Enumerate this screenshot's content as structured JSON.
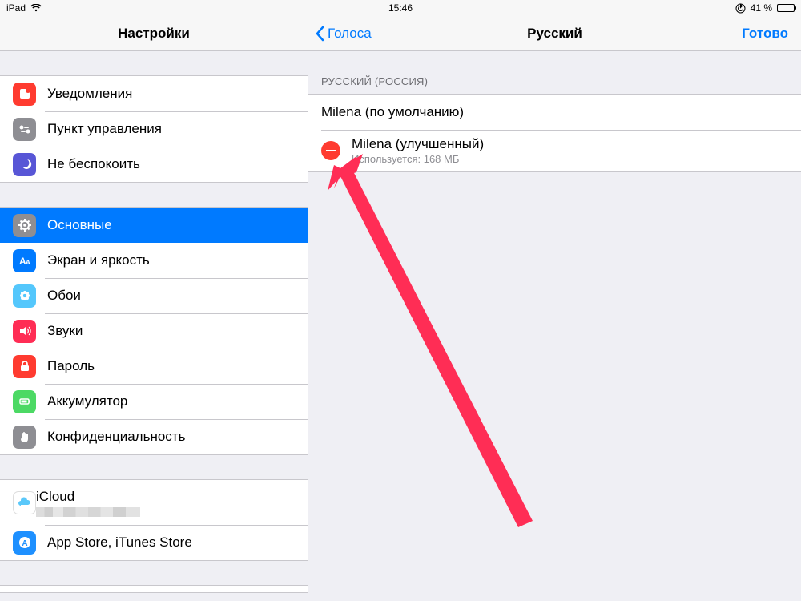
{
  "status": {
    "device": "iPad",
    "time": "15:46",
    "battery_pct": "41 %"
  },
  "sidebar": {
    "title": "Настройки",
    "groups": [
      {
        "items": [
          {
            "id": "notifications",
            "label": "Уведомления",
            "bg": "#ff3b30"
          },
          {
            "id": "control-center",
            "label": "Пункт управления",
            "bg": "#8e8e93"
          },
          {
            "id": "dnd",
            "label": "Не беспокоить",
            "bg": "#5856d6"
          }
        ]
      },
      {
        "items": [
          {
            "id": "general",
            "label": "Основные",
            "bg": "#8e8e93",
            "selected": true
          },
          {
            "id": "display",
            "label": "Экран и яркость",
            "bg": "#007aff"
          },
          {
            "id": "wallpaper",
            "label": "Обои",
            "bg": "#54c7fc"
          },
          {
            "id": "sounds",
            "label": "Звуки",
            "bg": "#ff2d55"
          },
          {
            "id": "passcode",
            "label": "Пароль",
            "bg": "#ff3b30"
          },
          {
            "id": "battery",
            "label": "Аккумулятор",
            "bg": "#4cd964"
          },
          {
            "id": "privacy",
            "label": "Конфиденциальность",
            "bg": "#8e8e93"
          }
        ]
      },
      {
        "items": [
          {
            "id": "icloud",
            "label": "iCloud",
            "bg": "#ffffff"
          },
          {
            "id": "appstore",
            "label": "App Store, iTunes Store",
            "bg": "#1e90ff"
          }
        ]
      }
    ]
  },
  "detail": {
    "back_label": "Голоса",
    "title": "Русский",
    "done_label": "Готово",
    "section_header": "РУССКИЙ (РОССИЯ)",
    "voices": [
      {
        "id": "milena-default",
        "title": "Milena (по умолчанию)"
      },
      {
        "id": "milena-enhanced",
        "title": "Milena (улучшенный)",
        "subtitle": "Используется: 168 МБ",
        "deletable": true
      }
    ]
  }
}
